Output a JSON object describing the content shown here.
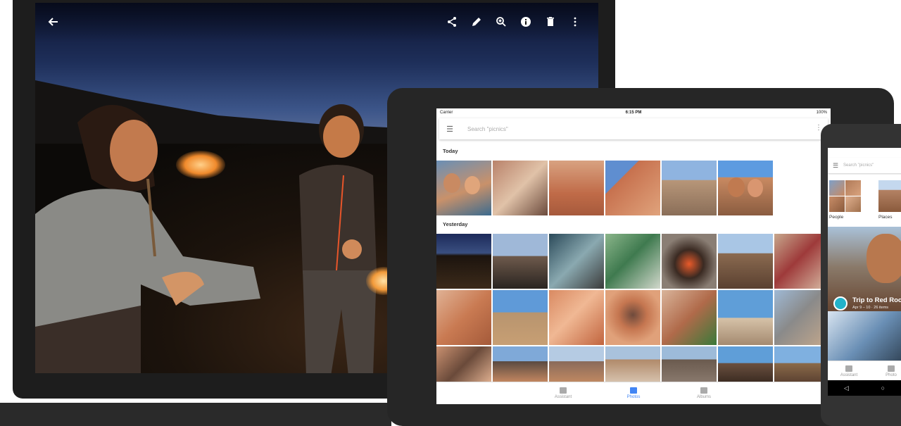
{
  "laptop": {
    "toolbar": {
      "back_icon": "arrow-back-icon",
      "share_icon": "share-icon",
      "edit_icon": "pencil-icon",
      "zoom_icon": "zoom-in-icon",
      "info_icon": "info-icon",
      "delete_icon": "trash-icon",
      "more_icon": "more-vert-icon"
    }
  },
  "tablet": {
    "status": {
      "carrier": "Carrier",
      "time": "6:15 PM",
      "battery": "100%"
    },
    "search": {
      "placeholder": "Search \"picnics\""
    },
    "sections": [
      {
        "label": "Today"
      },
      {
        "label": "Yesterday"
      }
    ],
    "nav": [
      {
        "label": "Assistant",
        "active": false
      },
      {
        "label": "Photos",
        "active": true
      },
      {
        "label": "Albums",
        "active": false
      }
    ]
  },
  "phone": {
    "search": {
      "placeholder": "Search \"picnics\""
    },
    "categories": [
      {
        "label": "People"
      },
      {
        "label": "Places"
      }
    ],
    "trip": {
      "title": "Trip to Red Rock",
      "subtitle": "Apr 9 – 10 · 26 items"
    },
    "nav": [
      {
        "label": "Assistant"
      },
      {
        "label": "Photo"
      }
    ]
  },
  "colors": {
    "accent": "#4285f4",
    "trip_badge": "#22b2c9",
    "device_frame": "#262626"
  }
}
